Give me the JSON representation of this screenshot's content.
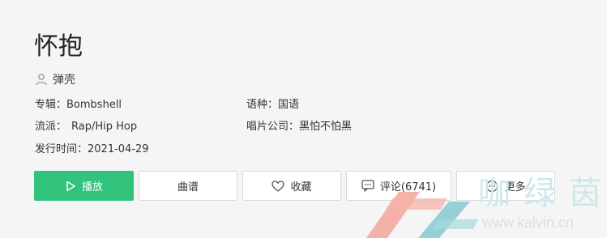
{
  "song": {
    "title": "怀抱",
    "artist": "弹壳"
  },
  "meta": {
    "album_label": "专辑：",
    "album_value": "Bombshell",
    "language_label": "语种：",
    "language_value": "国语",
    "genre_label": "流派：",
    "genre_value": "Rap/Hip Hop",
    "label_label": "唱片公司：",
    "label_value": "黑怕不怕黑",
    "release_label": "发行时间：",
    "release_value": "2021-04-29"
  },
  "actions": {
    "play": "播放",
    "score": "曲谱",
    "favorite": "收藏",
    "comment": "评论(6741)",
    "more": "更多"
  },
  "colors": {
    "primary": "#31c27c",
    "background": "#f5f5f5"
  },
  "icons": {
    "artist": "user-icon",
    "play": "play-icon",
    "favorite": "heart-icon",
    "comment": "comment-icon",
    "more": "more-icon"
  },
  "watermark": {
    "brand_chars": "咖绿茵",
    "url": "www.kalvin.cn"
  }
}
